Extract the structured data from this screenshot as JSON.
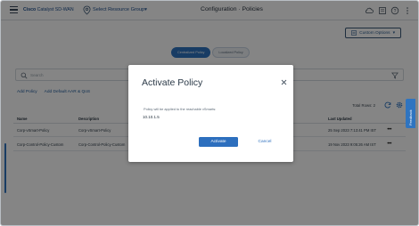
{
  "header": {
    "brand_prefix": "Cisco",
    "brand_product": "Catalyst SD-WAN",
    "resource_group": "Select Resource Group",
    "title": "Configuration · Policies"
  },
  "page": {
    "tabs": [
      {
        "label": "Centralized Policy",
        "active": true
      },
      {
        "label": "Localized Policy",
        "active": false
      }
    ],
    "custom_options": "Custom Options",
    "search_placeholder": "Search",
    "links": [
      "Add Policy",
      "Add Default AAR & QoS"
    ],
    "total_rows": "Total Rows: 2",
    "columns": [
      "Name",
      "Description",
      "Last Updated"
    ],
    "rows": [
      {
        "name": "Corp-vSmart-Policy",
        "description": "Corp-vSmart-Policy",
        "last_updated": "25 Sep 2023 7:13:41 PM IST"
      },
      {
        "name": "Corp-Control-Policy-Custom",
        "description": "Corp-Control-Policy-Custom",
        "last_updated": "19 Nov 2023 9:05:26 AM IST"
      }
    ],
    "feedback_label": "Feedback"
  },
  "modal": {
    "title": "Activate Policy",
    "message": "Policy will be applied to the reachable vSmarts:",
    "ip": "10.10.1.5",
    "activate_label": "Activate",
    "cancel_label": "Cancel"
  }
}
